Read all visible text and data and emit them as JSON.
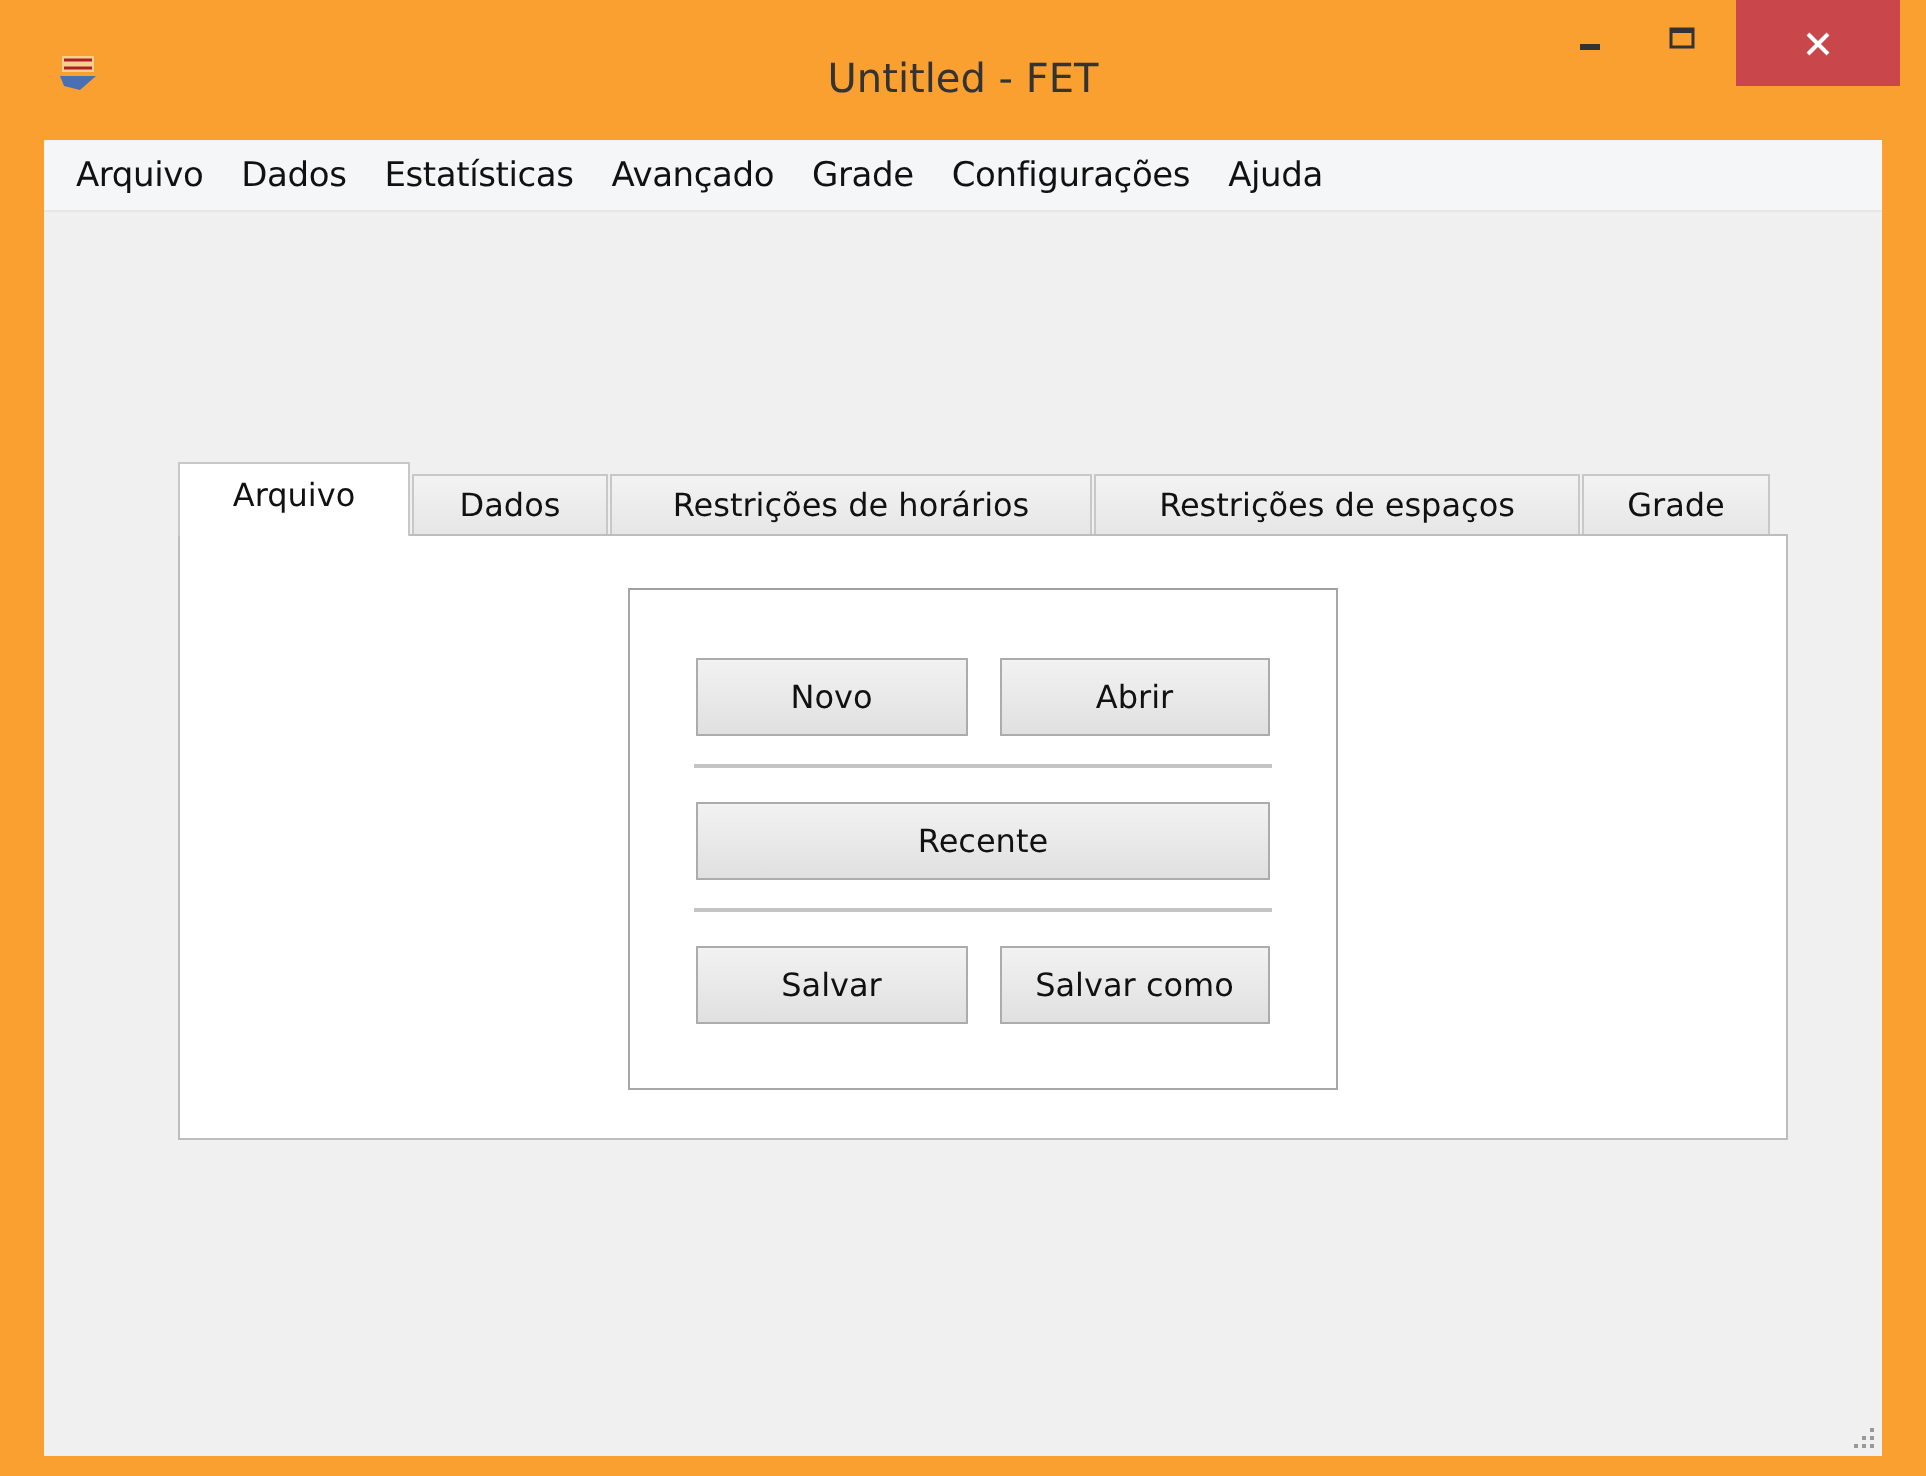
{
  "window": {
    "title": "Untitled - FET"
  },
  "menu": [
    "Arquivo",
    "Dados",
    "Estatísticas",
    "Avançado",
    "Grade",
    "Configurações",
    "Ajuda"
  ],
  "tabs": [
    {
      "label": "Arquivo",
      "selected": true
    },
    {
      "label": "Dados",
      "selected": false
    },
    {
      "label": "Restrições de horários",
      "selected": false
    },
    {
      "label": "Restrições de espaços",
      "selected": false
    },
    {
      "label": "Grade",
      "selected": false
    }
  ],
  "buttons": {
    "new": "Novo",
    "open": "Abrir",
    "recent": "Recente",
    "save": "Salvar",
    "save_as": "Salvar como"
  }
}
